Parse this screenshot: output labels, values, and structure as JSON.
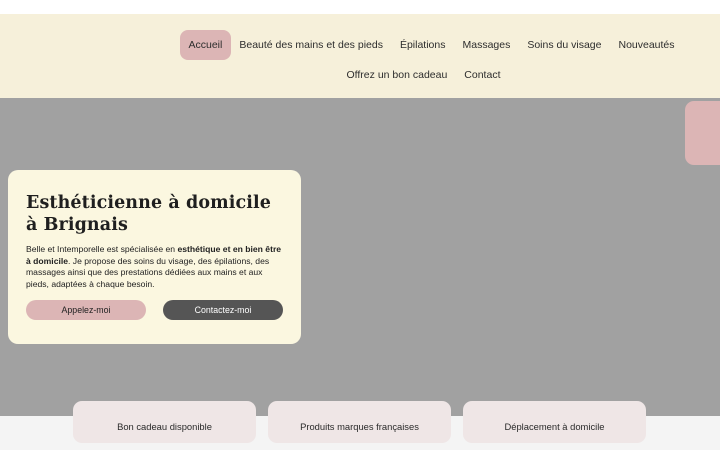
{
  "nav": {
    "row1": [
      {
        "label": "Accueil",
        "active": true
      },
      {
        "label": "Beauté des mains et des pieds"
      },
      {
        "label": "Épilations"
      },
      {
        "label": "Massages"
      },
      {
        "label": "Soins du visage"
      },
      {
        "label": "Nouveautés"
      }
    ],
    "row2": [
      {
        "label": "Offrez un bon cadeau"
      },
      {
        "label": "Contact"
      }
    ]
  },
  "hero": {
    "title": "Esthéticienne à domicile à Brignais",
    "text_a": "Belle et Intemporelle est spécialisée en ",
    "text_bold": "esthétique et en bien être à domicile",
    "text_b": ". Je propose des soins du visage, des épilations, des massages ainsi que des prestations dédiées aux mains et aux pieds, adaptées à chaque besoin.",
    "call_button": "Appelez-moi",
    "contact_button": "Contactez-moi"
  },
  "features": [
    "Bon cadeau disponible",
    "Produits marques françaises",
    "Déplacement à domicile"
  ],
  "colors": {
    "header_bg": "#f6f0da",
    "accent_pink": "#dcb5b5",
    "hero_gray": "#a1a1a1",
    "card_bg": "#fbf7e0",
    "dark_button": "#555555"
  }
}
